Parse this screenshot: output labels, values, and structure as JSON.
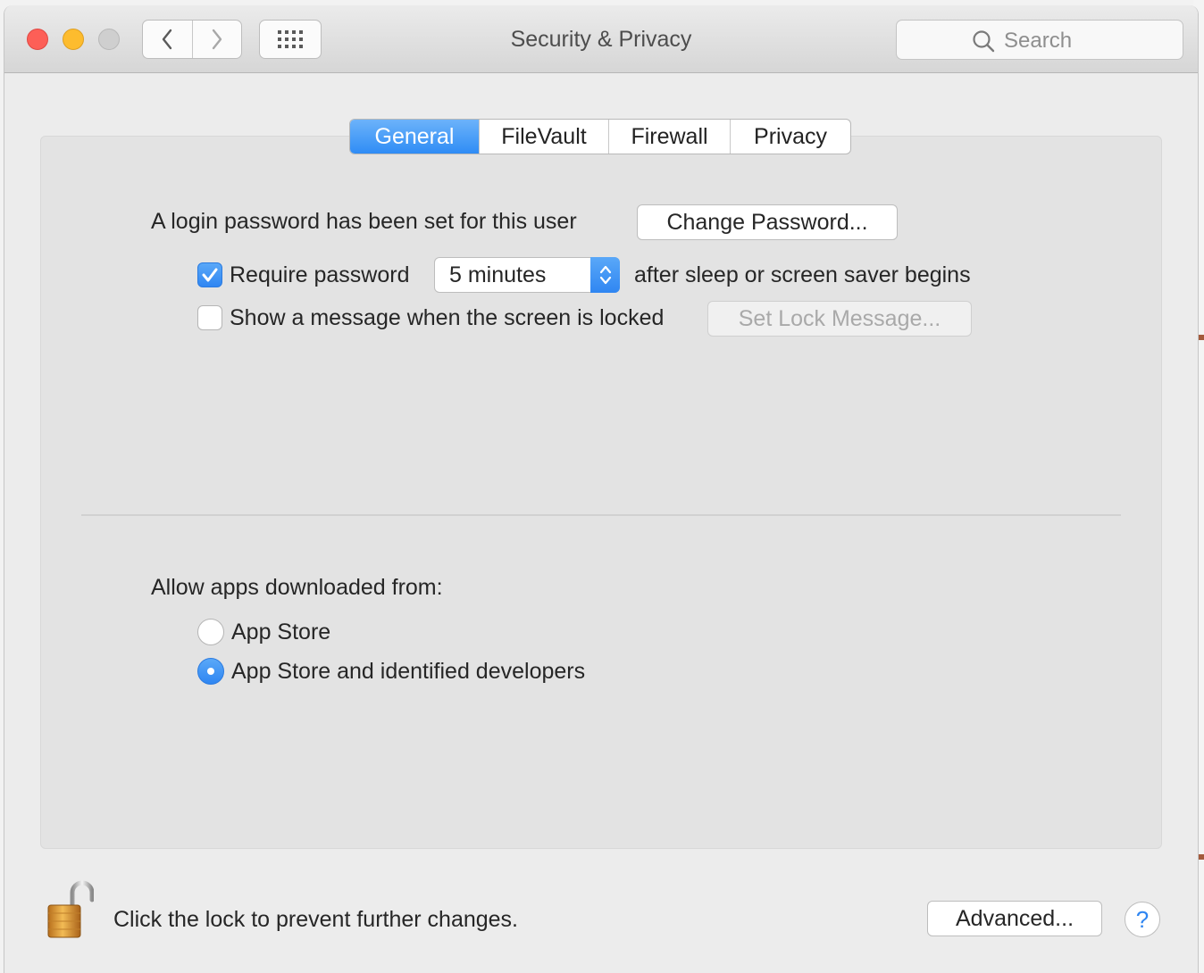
{
  "window": {
    "title": "Security & Privacy",
    "search_placeholder": "Search"
  },
  "tabs": [
    {
      "label": "General",
      "active": true
    },
    {
      "label": "FileVault",
      "active": false
    },
    {
      "label": "Firewall",
      "active": false
    },
    {
      "label": "Privacy",
      "active": false
    }
  ],
  "general": {
    "login_text": "A login password has been set for this user",
    "change_password_label": "Change Password...",
    "require_password_label": "Require password",
    "require_password_checked": true,
    "require_password_delay": "5 minutes",
    "after_sleep_text": "after sleep or screen saver begins",
    "show_message_label": "Show a message when the screen is locked",
    "show_message_checked": false,
    "set_lock_message_label": "Set Lock Message..."
  },
  "allow_apps": {
    "heading": "Allow apps downloaded from:",
    "options": [
      {
        "label": "App Store",
        "selected": false
      },
      {
        "label": "App Store and identified developers",
        "selected": true
      }
    ]
  },
  "footer": {
    "lock_text": "Click the lock to prevent further changes.",
    "advanced_label": "Advanced...",
    "help_label": "?"
  },
  "icons": {
    "lock": "lock-open-icon",
    "help": "help-icon",
    "search": "search-icon",
    "grid": "grid-icon"
  },
  "colors": {
    "accent": "#2f86f2",
    "close": "#fd5f57",
    "minimize": "#fdbc2e",
    "zoom_disabled": "#cfcfcf",
    "lock_gold": "#e0a03a"
  }
}
